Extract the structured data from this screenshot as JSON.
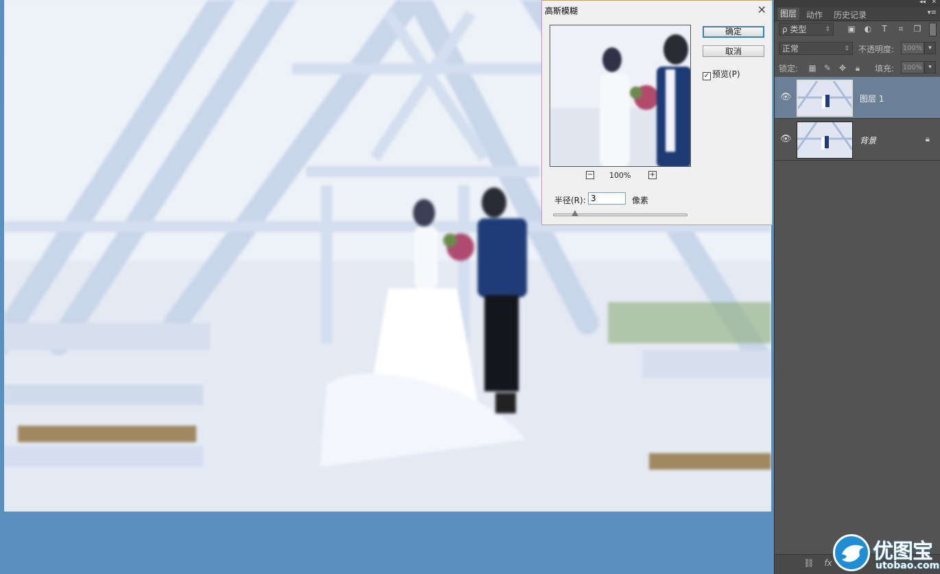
{
  "dialog": {
    "title": "高斯模糊",
    "close_icon": "×",
    "ok_label": "确定",
    "cancel_label": "取消",
    "preview_checkbox_label": "预览(P)",
    "preview_checked": true,
    "zoom_minus": "−",
    "zoom_plus": "+",
    "zoom_value": "100%",
    "radius_label": "半径(R):",
    "radius_value": "3",
    "radius_unit": "像素",
    "slider_value": 3
  },
  "panel": {
    "tabs": [
      {
        "label": "图层",
        "active": true
      },
      {
        "label": "动作",
        "active": false
      },
      {
        "label": "历史记录",
        "active": false
      }
    ],
    "filter_type_label": "ρ 类型",
    "filter_icons": [
      "image-icon",
      "adjustment-icon",
      "type-icon",
      "shape-icon",
      "smart-object-icon"
    ],
    "blend_mode": "正常",
    "opacity_label": "不透明度:",
    "opacity_value": "100%",
    "lock_label": "锁定:",
    "lock_icons": [
      "lock-transparent-icon",
      "lock-brush-icon",
      "lock-move-icon",
      "lock-all-icon"
    ],
    "fill_label": "填充:",
    "fill_value": "100%",
    "layers": [
      {
        "name": "图层 1",
        "active": true,
        "visible": true,
        "locked": false
      },
      {
        "name": "背景",
        "active": false,
        "visible": true,
        "locked": true
      }
    ],
    "bottom_icons": [
      "link-icon",
      "fx-icon"
    ]
  },
  "watermark": {
    "brand_cn": "优图宝",
    "url": "utobao.com",
    "accent": "#1e8fd6"
  }
}
